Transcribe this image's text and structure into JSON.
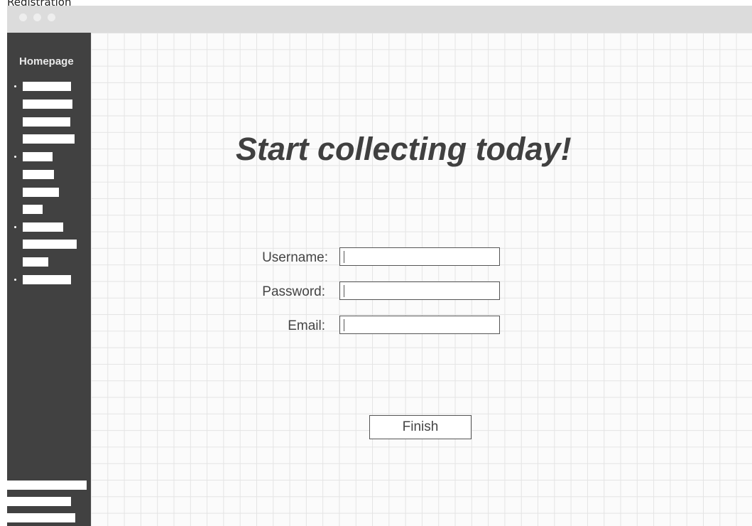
{
  "caption": "Registration",
  "sidebar": {
    "title": "Homepage"
  },
  "main": {
    "headline": "Start collecting today!",
    "fields": [
      {
        "label": "Username:",
        "value": "|"
      },
      {
        "label": "Password:",
        "value": "|"
      },
      {
        "label": "Email:",
        "value": "|"
      }
    ],
    "finish_label": "Finish"
  },
  "colors": {
    "sidebar": "#414141",
    "titlebar": "#dcdcdc",
    "grid": "#e4e4e4",
    "text": "#404040"
  }
}
